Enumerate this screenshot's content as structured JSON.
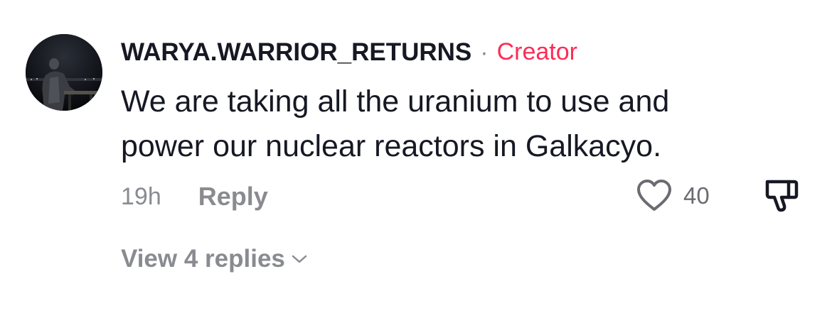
{
  "comment": {
    "username": "WARYA.WARRIOR_RETURNS",
    "separator": "·",
    "badge": "Creator",
    "text_line1": "We are taking all the uranium to use and",
    "text_line2": "power our nuclear reactors in Galkacyo.",
    "timestamp": "19h",
    "reply_label": "Reply",
    "like_count": "40",
    "view_replies_label": "View 4 replies"
  },
  "icons": {
    "like": "heart-outline-icon",
    "dislike": "thumbs-down-icon",
    "expand": "chevron-down-icon"
  },
  "colors": {
    "text": "#161823",
    "secondary": "#8a8b91",
    "creator_badge": "#fe2c55"
  }
}
